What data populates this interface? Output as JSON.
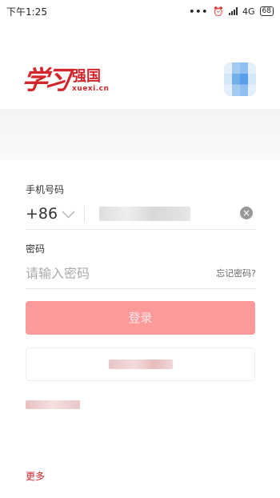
{
  "status_bar": {
    "time": "下午1:25",
    "dots": "•••",
    "network": "4G",
    "battery": "68"
  },
  "logo": {
    "script_text": "学习",
    "name": "强国",
    "url": "xuexi.cn"
  },
  "form": {
    "phone_label": "手机号码",
    "country_code": "+86",
    "phone_value": "",
    "password_label": "密码",
    "password_placeholder": "请输入密码",
    "forgot_password": "忘记密码?",
    "login_button": "登录",
    "secondary_button": "",
    "secondary_link": ""
  },
  "footer": {
    "more": "更多"
  },
  "colors": {
    "brand_red": "#d3262c",
    "login_button_bg": "#fa9a9a"
  }
}
